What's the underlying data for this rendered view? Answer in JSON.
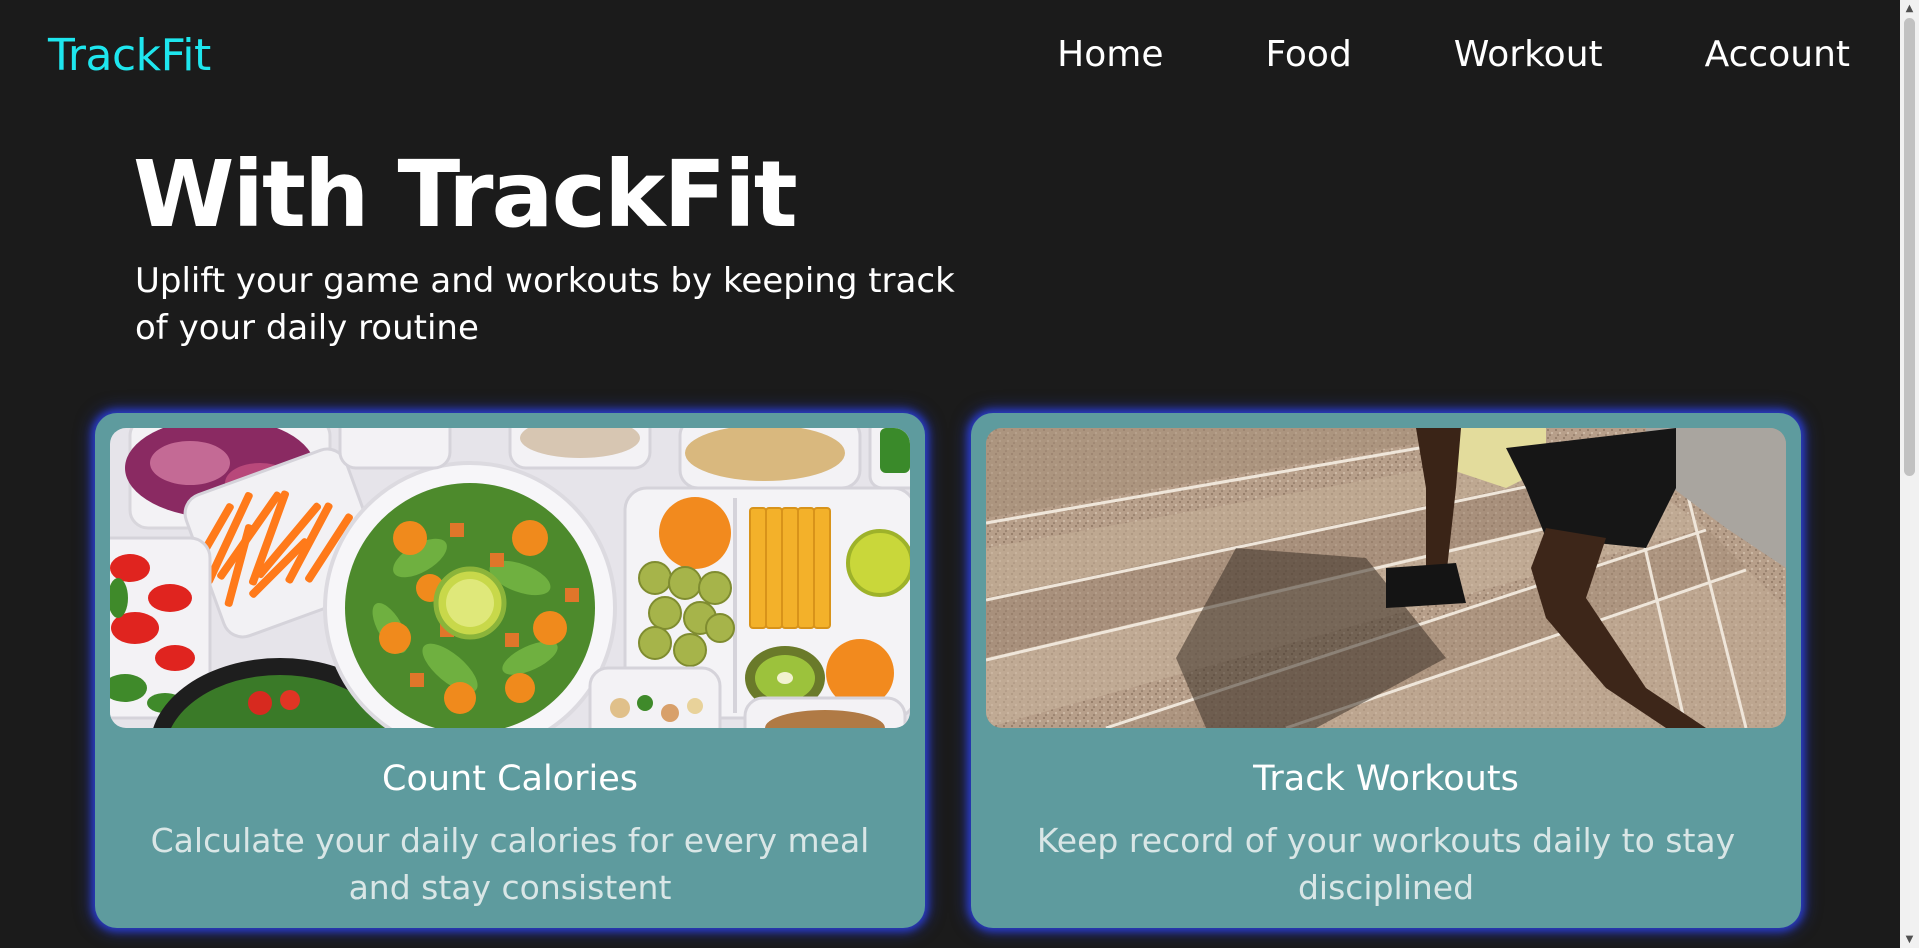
{
  "brand": {
    "name": "TrackFit",
    "color": "#1ee6ee"
  },
  "nav": {
    "items": [
      {
        "label": "Home"
      },
      {
        "label": "Food"
      },
      {
        "label": "Workout"
      },
      {
        "label": "Account"
      }
    ]
  },
  "hero": {
    "title": "With TrackFit",
    "subtitle": "Uplift your game and workouts by keeping track of your daily routine"
  },
  "cards": [
    {
      "title": "Count Calories",
      "description": "Calculate your daily calories for every meal and stay consistent",
      "image": "meal-prep-containers-photo"
    },
    {
      "title": "Track Workouts",
      "description": "Keep record of your workouts daily to stay disciplined",
      "image": "person-running-up-stairs-photo"
    }
  ],
  "colors": {
    "background": "#1b1b1b",
    "card": "#5e9b9e",
    "card_glow": "#2a3cc8"
  }
}
